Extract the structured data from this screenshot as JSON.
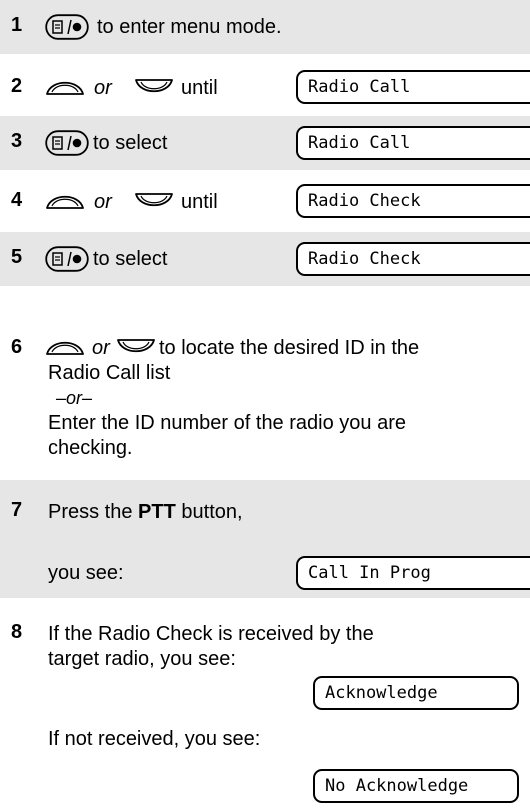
{
  "steps": [
    {
      "number": "1",
      "text": "to enter menu mode."
    },
    {
      "number": "2",
      "or": "or",
      "text": "until",
      "display": "Radio Call"
    },
    {
      "number": "3",
      "text": "to select",
      "display": "Radio Call"
    },
    {
      "number": "4",
      "or": "or",
      "text": "until",
      "display": "Radio Check"
    },
    {
      "number": "5",
      "text": "to select",
      "display": "Radio Check"
    },
    {
      "number": "6",
      "or": "or",
      "line1": "to locate the desired ID in the",
      "line2": "Radio Call list",
      "alt": "–or–",
      "line3": "Enter the ID number of the radio you are",
      "line4": "checking."
    },
    {
      "number": "7",
      "text_pre": "Press the ",
      "bold": "PTT",
      "text_post": " button,",
      "sub": "you see:",
      "display": "Call In Prog"
    },
    {
      "number": "8",
      "line1": "If the Radio Check is received by the",
      "line2": "target radio, you see:",
      "display1": "Acknowledge",
      "line3": "If not received, you see:",
      "display2": "No Acknowledge"
    }
  ],
  "icons": {
    "menu_select": "menu-select-button-icon",
    "up": "scroll-up-button-icon",
    "down": "scroll-down-button-icon"
  },
  "colors": {
    "shade": "#e6e6e6"
  }
}
